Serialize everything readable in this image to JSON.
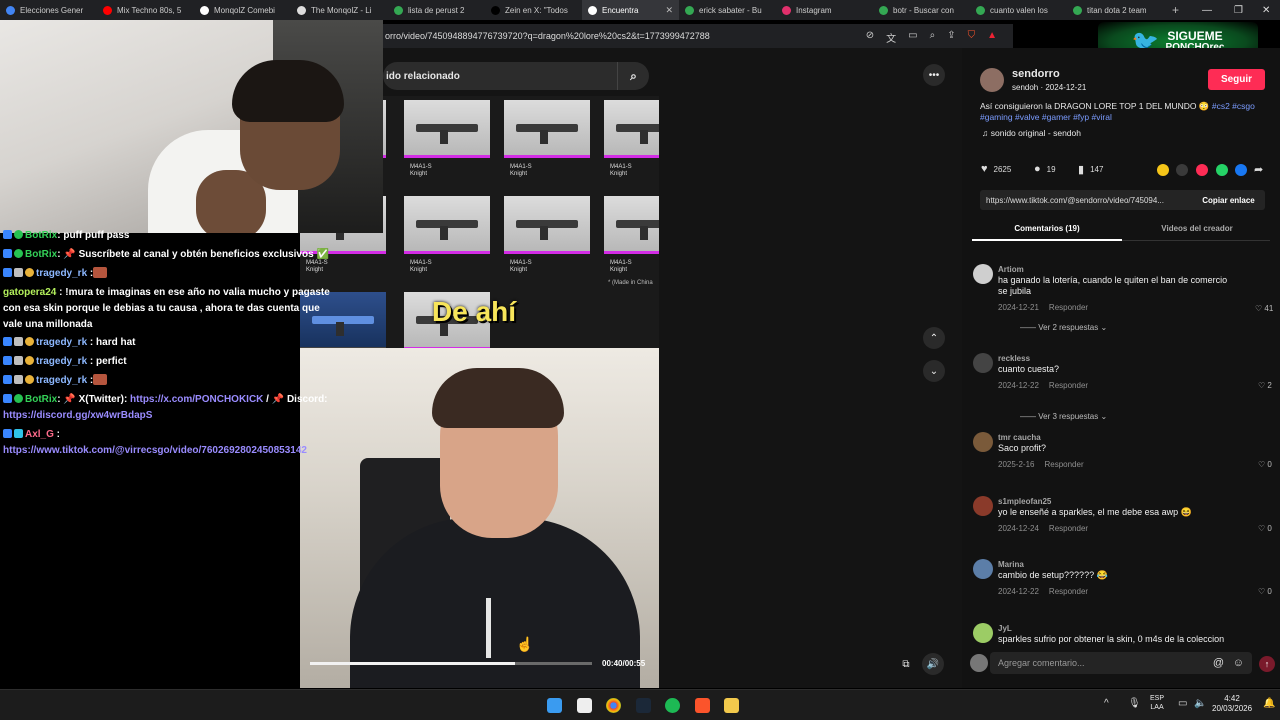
{
  "browser": {
    "tabs": [
      {
        "label": "Elecciones Gener",
        "color": "#4285f4"
      },
      {
        "label": "Mix Techno 80s, 5",
        "color": "#ff0000"
      },
      {
        "label": "MonqolZ Comebi",
        "color": "#ffffff"
      },
      {
        "label": "The MonqolZ - Li",
        "color": "#dddddd"
      },
      {
        "label": "lista de perust 2",
        "color": "#34a853"
      },
      {
        "label": "Zein en X: \"Todos",
        "color": "#000000"
      },
      {
        "label": "Encuentra",
        "color": "#ffffff",
        "active": true
      },
      {
        "label": "erick sabater - Bu",
        "color": "#34a853"
      },
      {
        "label": "Instagram",
        "color": "#e1306c"
      },
      {
        "label": "botr - Buscar con",
        "color": "#34a853"
      },
      {
        "label": "cuanto valen los",
        "color": "#34a853"
      },
      {
        "label": "titan dota 2 team",
        "color": "#34a853"
      }
    ],
    "new_tab": "+",
    "close_glyph": "✕",
    "win_min": "—",
    "win_max": "❐",
    "win_close": "✕",
    "url": "orro/video/7450948894776739720?q=dragon%20lore%20cs2&t=1773999472788"
  },
  "banner": {
    "line1": "SIGUEME",
    "line2": "PONCHOrec"
  },
  "search": {
    "placeholder": "ido relacionado",
    "icon": "search-icon"
  },
  "video": {
    "item_label": "M4A1-S",
    "item_sub": "Knight",
    "caption": "De ahí",
    "made_in": "* (Made in China",
    "elapsed": "00:40",
    "duration": "00:55",
    "progress": 0.727
  },
  "chat": [
    {
      "user": "BotRix",
      "text": ": puff puff pass",
      "ucolor": "u-green",
      "badges": [
        "b-blue",
        "b-green"
      ]
    },
    {
      "user": "BotRix",
      "text": ": 📌 Suscríbete al canal y obtén beneficios exclusivos ✅",
      "ucolor": "u-green",
      "badges": [
        "b-blue",
        "b-green"
      ]
    },
    {
      "user": "tragedy_rk",
      "text": " :",
      "ucolor": "u-blue",
      "badges": [
        "b-blue",
        "b-gray",
        "b-gold"
      ],
      "emote": true
    },
    {
      "user": "gatopera24",
      "text": " : !mura te imaginas en ese año no valia mucho y pagaste",
      "ucolor": "u-lime",
      "badges": []
    },
    {
      "user": "",
      "text": "con esa skin porque le debias a tu causa , ahora te das cuenta que",
      "ucolor": "",
      "badges": []
    },
    {
      "user": "",
      "text": "vale una millonada",
      "ucolor": "",
      "badges": []
    },
    {
      "user": "tragedy_rk",
      "text": " : hard hat",
      "ucolor": "u-blue",
      "badges": [
        "b-blue",
        "b-gray",
        "b-gold"
      ]
    },
    {
      "user": "tragedy_rk",
      "text": " : perfict",
      "ucolor": "u-blue",
      "badges": [
        "b-blue",
        "b-gray",
        "b-gold"
      ]
    },
    {
      "user": "tragedy_rk",
      "text": " :",
      "ucolor": "u-blue",
      "badges": [
        "b-blue",
        "b-gray",
        "b-gold"
      ],
      "emote": true
    },
    {
      "user": "BotRix",
      "text": ": 📌 X(Twitter): ",
      "ucolor": "u-green",
      "badges": [
        "b-blue",
        "b-green"
      ],
      "link": "https://x.com/PONCHOKICK",
      "after": " / 📌 Discord:"
    },
    {
      "user": "",
      "text": "",
      "ucolor": "",
      "badges": [],
      "link": "https://discord.gg/xw4wrBdapS"
    },
    {
      "user": "Axl_G",
      "text": " :",
      "ucolor": "u-pink",
      "badges": [
        "b-blue",
        "b-cyan"
      ]
    },
    {
      "user": "",
      "text": "",
      "ucolor": "",
      "badges": [],
      "link": "https://www.tiktok.com/@virrecsgo/video/7602692802450853142"
    }
  ],
  "post": {
    "author": "sendorro",
    "handle_date": "sendoh · 2024-12-21",
    "follow_label": "Seguir",
    "caption": "Así consiguieron la DRAGON LORE TOP 1 DEL MUNDO 😳",
    "tags1": "#cs2 #csgo",
    "tags2": "#gaming #valve #gamer #fyp",
    "tags2_end": "#viral",
    "sound": "♫  sonido original - sendoh",
    "likes": "2625",
    "comments": "19",
    "saves": "147",
    "link": "https://www.tiktok.com/@sendorro/video/745094...",
    "copy_label": "Copiar enlace",
    "tab_comments": "Comentarios (19)",
    "tab_creator": "Videos del creador"
  },
  "comments": [
    {
      "name": "Artiom",
      "text": "ha ganado la lotería, cuando le quiten el ban de comercio",
      "text2": "se jubila",
      "date": "2024-12-21",
      "reply": "Responder",
      "likes": "41",
      "more": "Ver 2 respuestas"
    },
    {
      "name": "reckless",
      "text": "cuanto cuesta?",
      "text2": "",
      "date": "2024-12-22",
      "reply": "Responder",
      "likes": "2",
      "more": "Ver 3 respuestas"
    },
    {
      "name": "tmr caucha",
      "text": "Saco profit?",
      "text2": "",
      "date": "2025-2-16",
      "reply": "Responder",
      "likes": "0",
      "more": ""
    },
    {
      "name": "s1mpleofan25",
      "text": "yo le enseñé a sparkles, el me debe esa awp 😆",
      "text2": "",
      "date": "2024-12-24",
      "reply": "Responder",
      "likes": "0",
      "more": ""
    },
    {
      "name": "Marina",
      "text": "cambio de setup?????? 😂",
      "text2": "",
      "date": "2024-12-22",
      "reply": "Responder",
      "likes": "0",
      "more": ""
    },
    {
      "name": "JyL",
      "text": "sparkles sufrio por obtener la skin, 0 m4s de la coleccion",
      "text2": "",
      "date": "",
      "reply": "",
      "likes": "",
      "more": ""
    }
  ],
  "input": {
    "placeholder": "Agregar comentario..."
  },
  "taskbar": {
    "lang1": "ESP",
    "lang2": "LAA",
    "time": "4:42",
    "date": "20/03/2026"
  },
  "colors": {
    "accent": "#fe2c55",
    "tiktok_bg": "#121212",
    "tag": "#7b9cff"
  }
}
